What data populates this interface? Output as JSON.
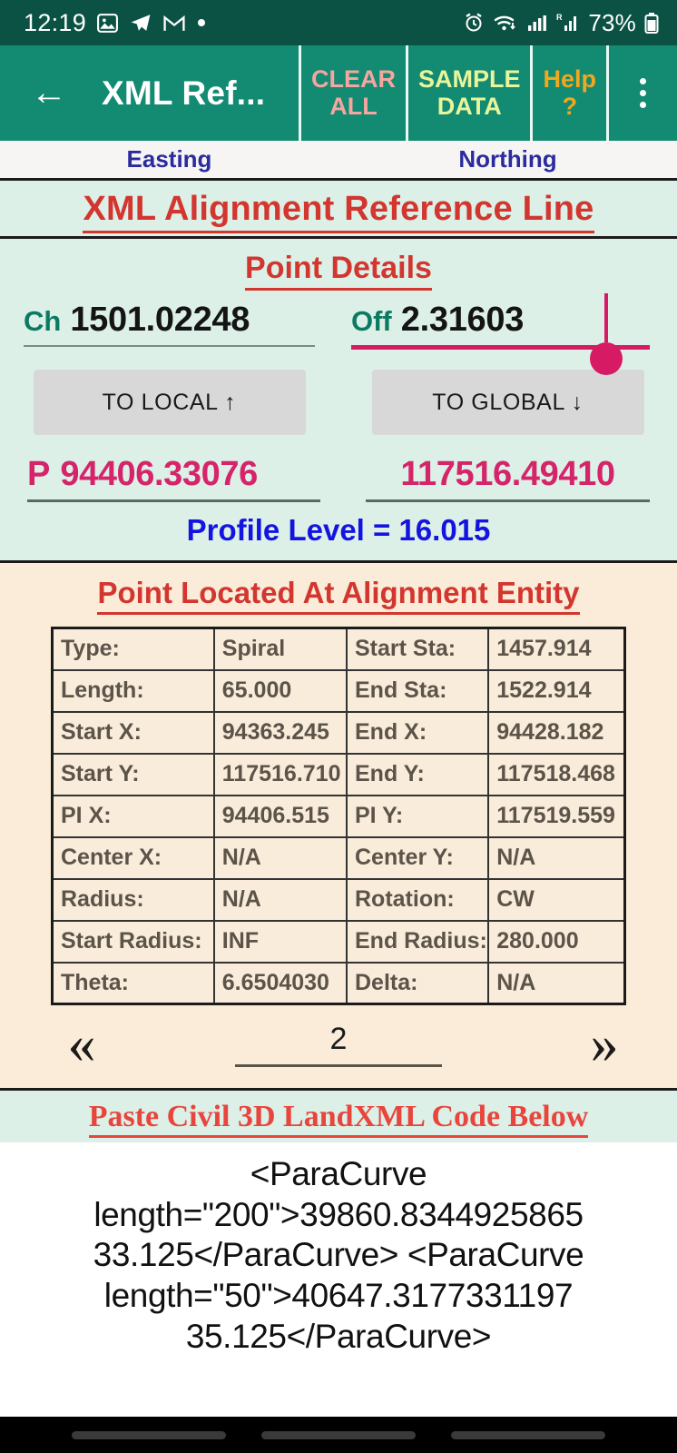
{
  "statusbar": {
    "time": "12:19",
    "battery": "73%",
    "icons_left": [
      "photos-icon",
      "telegram-icon",
      "gmail-icon",
      "dot-icon"
    ],
    "icons_right": [
      "alarm-icon",
      "wifi-icon",
      "signal-icon",
      "roaming-signal-icon",
      "battery-icon"
    ]
  },
  "appbar": {
    "back": "←",
    "title": "XML Ref...",
    "clear_all": "CLEAR\nALL",
    "clear_all_line1": "CLEAR",
    "clear_all_line2": "ALL",
    "sample_data_line1": "SAMPLE",
    "sample_data_line2": "DATA",
    "help_line1": "Help",
    "help_line2": "?",
    "overflow": "kebab-menu"
  },
  "columns": {
    "left": "Easting",
    "right": "Northing"
  },
  "headings": {
    "main": "XML Alignment Reference Line",
    "point_details": "Point Details",
    "entity": "Point Located At Alignment Entity",
    "paste": "Paste Civil 3D LandXML Code Below"
  },
  "inputs": {
    "ch_label": "Ch",
    "ch_value": "1501.02248",
    "off_label": "Off",
    "off_value": "2.31603"
  },
  "buttons": {
    "to_local": "TO LOCAL ↑",
    "to_global": "TO GLOBAL ↓"
  },
  "outputs": {
    "p_label": "P",
    "easting": "94406.33076",
    "northing": "117516.49410",
    "profile": "Profile Level = 16.015"
  },
  "entity_table": [
    {
      "k1": "Type:",
      "v1": "Spiral",
      "k2": "Start Sta:",
      "v2": "1457.914"
    },
    {
      "k1": "Length:",
      "v1": "65.000",
      "k2": "End Sta:",
      "v2": "1522.914"
    },
    {
      "k1": "Start X:",
      "v1": "94363.245",
      "k2": "End X:",
      "v2": "94428.182"
    },
    {
      "k1": "Start Y:",
      "v1": "117516.710",
      "k2": "End Y:",
      "v2": "117518.468"
    },
    {
      "k1": "PI X:",
      "v1": "94406.515",
      "k2": "PI Y:",
      "v2": "117519.559"
    },
    {
      "k1": "Center X:",
      "v1": "N/A",
      "k2": "Center Y:",
      "v2": "N/A"
    },
    {
      "k1": "Radius:",
      "v1": "N/A",
      "k2": "Rotation:",
      "v2": "CW"
    },
    {
      "k1": "Start Radius:",
      "v1": "INF",
      "k2": "End Radius:",
      "v2": "280.000"
    },
    {
      "k1": "Theta:",
      "v1": "6.6504030",
      "k2": "Delta:",
      "v2": "N/A"
    }
  ],
  "pager": {
    "prev": "«",
    "next": "»",
    "page": "2"
  },
  "xml_code": "<ParaCurve length=\"200\">39860.8344925865 33.125</ParaCurve>\n<ParaCurve length=\"50\">40647.3177331197 35.125</ParaCurve>",
  "colors": {
    "status_bar": "#0b5244",
    "app_bar": "#138a72",
    "mint_panel": "#dcf0e8",
    "peach_panel": "#faecd8",
    "heading_red": "#d2362f",
    "output_pink": "#d6246a",
    "profile_blue": "#1414e0",
    "column_header_blue": "#2b2b9e",
    "clear_all": "#f4a6a0",
    "sample_data": "#e9f59a",
    "help": "#f0a81e",
    "button_gray": "#d8d8d8"
  }
}
